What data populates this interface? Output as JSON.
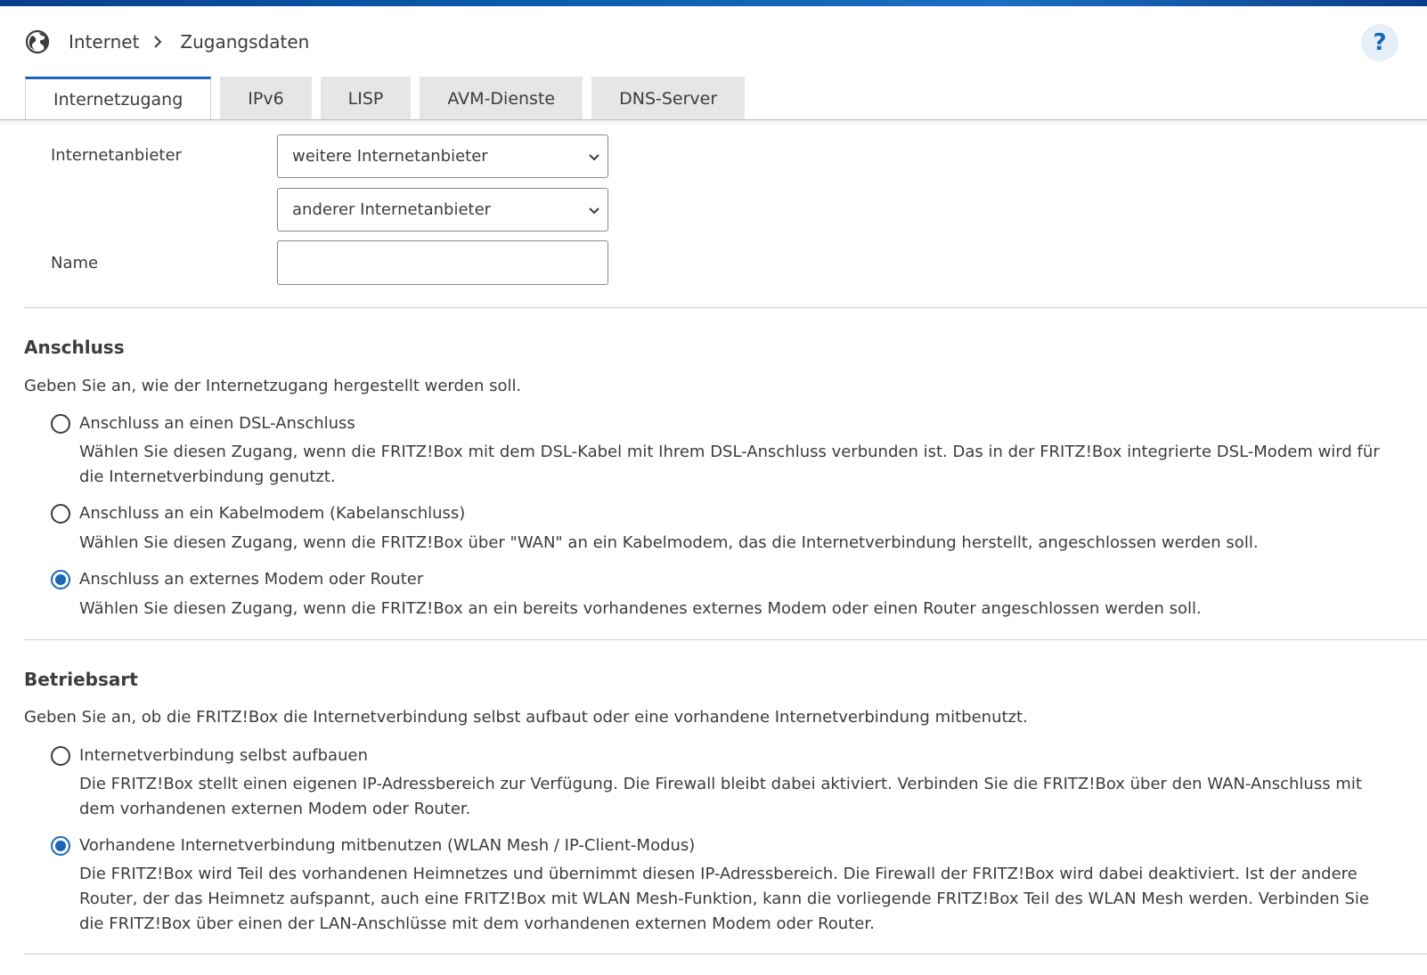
{
  "header": {
    "icon": "globe-icon",
    "breadcrumb": [
      "Internet",
      "Zugangsdaten"
    ],
    "help_label": "?"
  },
  "tabs": [
    {
      "label": "Internetzugang",
      "active": true
    },
    {
      "label": "IPv6",
      "active": false
    },
    {
      "label": "LISP",
      "active": false
    },
    {
      "label": "AVM-Dienste",
      "active": false
    },
    {
      "label": "DNS-Server",
      "active": false
    }
  ],
  "provider": {
    "label": "Internetanbieter",
    "select1_value": "weitere Internetanbieter",
    "select2_value": "anderer Internetanbieter",
    "name_label": "Name",
    "name_value": ""
  },
  "anschluss": {
    "title": "Anschluss",
    "intro": "Geben Sie an, wie der Internetzugang hergestellt werden soll.",
    "options": [
      {
        "label": "Anschluss an einen DSL-Anschluss",
        "checked": false,
        "desc": "Wählen Sie diesen Zugang, wenn die FRITZ!Box mit dem DSL-Kabel mit Ihrem DSL-Anschluss verbunden ist. Das in der FRITZ!Box integrierte DSL-Modem wird für die Internetverbindung genutzt."
      },
      {
        "label": "Anschluss an ein Kabelmodem (Kabelanschluss)",
        "checked": false,
        "desc": "Wählen Sie diesen Zugang, wenn die FRITZ!Box über \"WAN\" an ein Kabelmodem, das die Internetverbindung herstellt, angeschlossen werden soll."
      },
      {
        "label": "Anschluss an externes Modem oder Router",
        "checked": true,
        "desc": "Wählen Sie diesen Zugang, wenn die FRITZ!Box an ein bereits vorhandenes externes Modem oder einen Router angeschlossen werden soll."
      }
    ]
  },
  "betriebsart": {
    "title": "Betriebsart",
    "intro": "Geben Sie an, ob die FRITZ!Box die Internetverbindung selbst aufbaut oder eine vorhandene Internetverbindung mitbenutzt.",
    "options": [
      {
        "label": "Internetverbindung selbst aufbauen",
        "checked": false,
        "desc": "Die FRITZ!Box stellt einen eigenen IP-Adressbereich zur Verfügung. Die Firewall bleibt dabei aktiviert. Verbinden Sie die FRITZ!Box über den WAN-Anschluss mit dem vorhandenen externen Modem oder Router."
      },
      {
        "label": "Vorhandene Internetverbindung mitbenutzen (WLAN Mesh / IP-Client-Modus)",
        "checked": true,
        "desc": "Die FRITZ!Box wird Teil des vorhandenen Heimnetzes und übernimmt diesen IP-Adressbereich. Die Firewall der FRITZ!Box wird dabei deaktiviert. Ist der andere Router, der das Heimnetz aufspannt, auch eine FRITZ!Box mit WLAN Mesh-Funktion, kann die vorliegende FRITZ!Box Teil des WLAN Mesh werden. Verbinden Sie die FRITZ!Box über einen der LAN-Anschlüsse mit dem vorhandenen externen Modem oder Router."
      }
    ]
  }
}
